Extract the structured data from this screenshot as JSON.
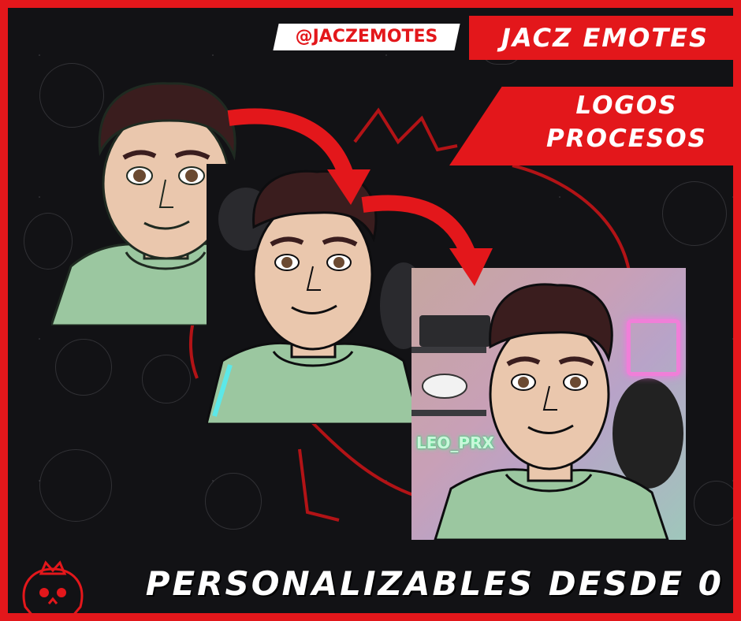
{
  "handle": "@JACZEMOTES",
  "brand": "JACZ EMOTES",
  "subtitle_lines": [
    "LOGOS",
    "PROCESOS"
  ],
  "bottom_text": "PERSONALIZABLES DESDE 0",
  "panel3_name_text": "LEO_PRX",
  "colors": {
    "accent": "#e3171b",
    "background": "#121215",
    "shirt": "#9bc7a0",
    "skin": "#eac7ad",
    "hair": "#3a1d1e",
    "neon_pink": "#f07fd8",
    "neon_green": "#55ff9a"
  },
  "icons": [
    "crown-skull-logo",
    "twitch-icon",
    "arrow-icon"
  ]
}
